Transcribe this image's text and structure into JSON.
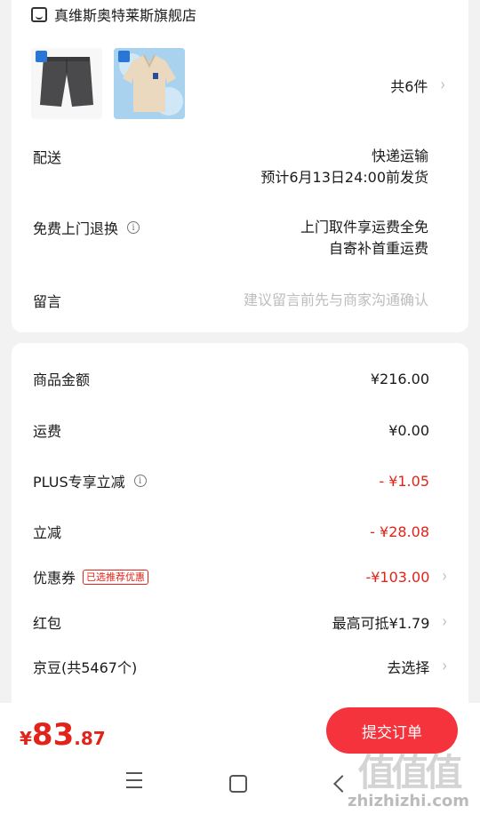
{
  "shop": {
    "name": "真维斯奥特莱斯旗舰店",
    "icon": "shop-icon"
  },
  "products": {
    "count_label": "共6件",
    "items": [
      {
        "name": "shorts",
        "icon": "shorts-thumbnail"
      },
      {
        "name": "polo-shirt",
        "icon": "polo-thumbnail"
      }
    ]
  },
  "delivery": {
    "label": "配送",
    "method": "快递运输",
    "estimate": "预计6月13日24:00前发货"
  },
  "return": {
    "label": "免费上门退换",
    "line1": "上门取件享运费全免",
    "line2": "自寄补首重运费"
  },
  "message": {
    "label": "留言",
    "placeholder": "建议留言前先与商家沟通确认"
  },
  "summary": {
    "goods": {
      "label": "商品金额",
      "value": "¥216.00"
    },
    "shipping": {
      "label": "运费",
      "value": "¥0.00"
    },
    "plus": {
      "label": "PLUS专享立减",
      "value": "- ¥1.05"
    },
    "discount": {
      "label": "立减",
      "value": "- ¥28.08"
    },
    "coupon": {
      "label": "优惠券",
      "tag": "已选推荐优惠",
      "value": "-¥103.00"
    },
    "redpacket": {
      "label": "红包",
      "value": "最高可抵¥1.79"
    },
    "jingdou": {
      "label": "京豆(共5467个)",
      "value": "去选择"
    }
  },
  "footer": {
    "currency": "¥",
    "total_int": "83",
    "total_dec": ".87",
    "submit_label": "提交订单"
  },
  "watermark": {
    "big": "值值值",
    "small": "zhizhizhi.com"
  },
  "colors": {
    "accent": "#e2231a",
    "button": "#f5333d"
  }
}
